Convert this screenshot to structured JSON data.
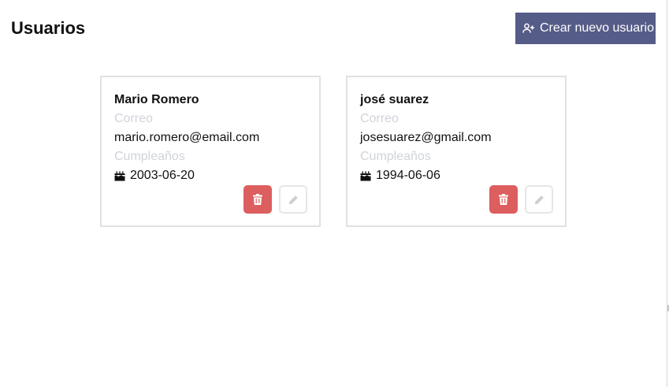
{
  "header": {
    "title": "Usuarios",
    "create_button_label": "Crear nuevo usuario",
    "create_button_icon": "user-plus-icon"
  },
  "labels": {
    "email": "Correo",
    "birthday": "Cumpleaños"
  },
  "users": [
    {
      "name": "Mario Romero",
      "email": "mario.romero@email.com",
      "birthday": "2003-06-20"
    },
    {
      "name": "josé suarez",
      "email": "josesuarez@gmail.com",
      "birthday": "1994-06-06"
    }
  ],
  "icons": {
    "birthday": "birthday-cake-icon",
    "delete": "trash-icon",
    "edit": "pencil-icon"
  },
  "colors": {
    "primary": "#565c88",
    "danger": "#dc5e5e",
    "muted_label": "#d0d3da",
    "card_border": "#e1e1e1"
  }
}
